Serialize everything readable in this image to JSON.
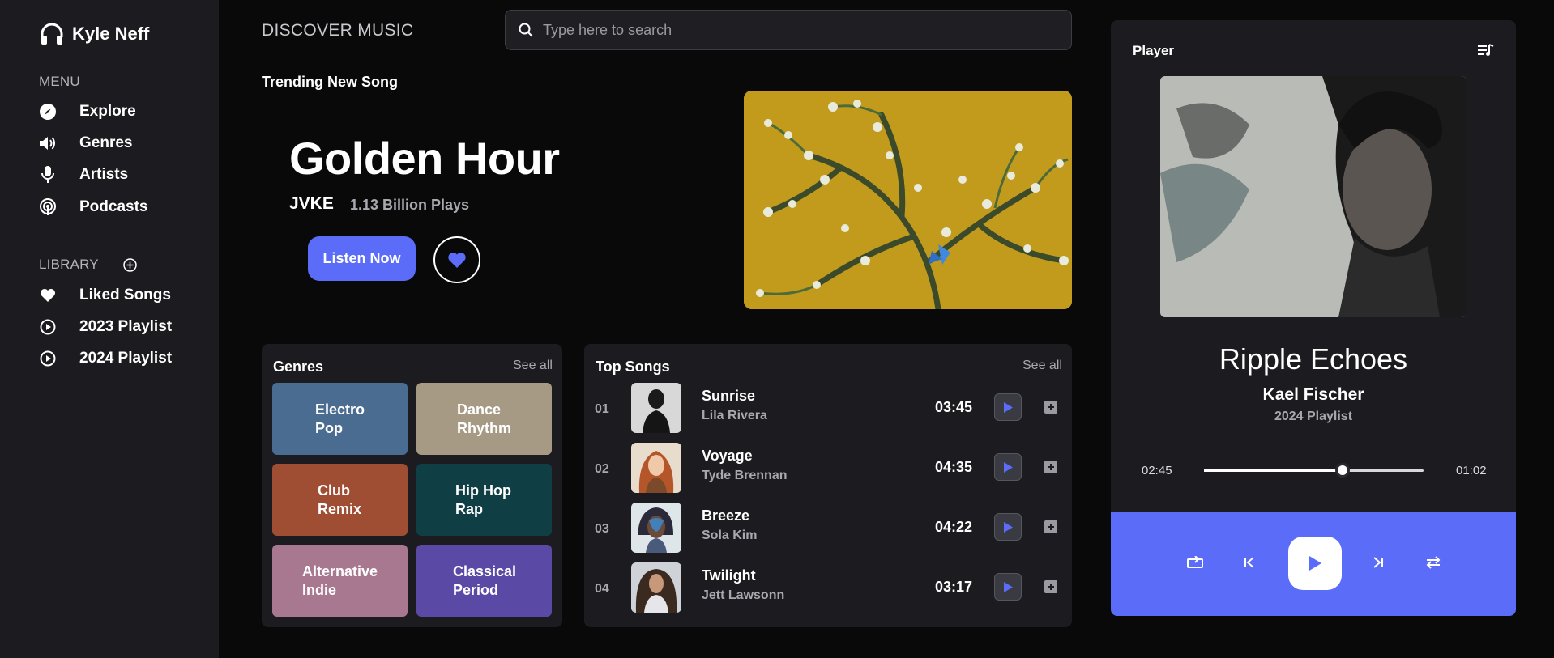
{
  "user": {
    "name": "Kyle Neff"
  },
  "sidebar": {
    "menu_label": "MENU",
    "menu_items": [
      {
        "label": "Explore",
        "icon": "compass-icon"
      },
      {
        "label": "Genres",
        "icon": "speaker-icon"
      },
      {
        "label": "Artists",
        "icon": "microphone-icon"
      },
      {
        "label": "Podcasts",
        "icon": "podcast-icon"
      }
    ],
    "library_label": "LIBRARY",
    "library_items": [
      {
        "label": "Liked Songs",
        "icon": "heart-icon"
      },
      {
        "label": "2023 Playlist",
        "icon": "play-circle-icon"
      },
      {
        "label": "2024 Playlist",
        "icon": "play-circle-icon"
      }
    ]
  },
  "header": {
    "title": "DISCOVER MUSIC",
    "search_placeholder": "Type here to search"
  },
  "hero": {
    "label": "Trending New Song",
    "title": "Golden Hour",
    "artist": "JVKE",
    "plays": "1.13 Billion Plays",
    "listen_label": "Listen Now"
  },
  "genres": {
    "title": "Genres",
    "see_all": "See all",
    "items": [
      {
        "line1": "Electro",
        "line2": "Pop",
        "color": "#4a6c90"
      },
      {
        "line1": "Dance",
        "line2": "Rhythm",
        "color": "#a69a84"
      },
      {
        "line1": "Club",
        "line2": "Remix",
        "color": "#a04e33"
      },
      {
        "line1": "Hip Hop",
        "line2": "Rap",
        "color": "#0f3f44"
      },
      {
        "line1": "Alternative",
        "line2": "Indie",
        "color": "#a87891"
      },
      {
        "line1": "Classical",
        "line2": "Period",
        "color": "#5a4aa5"
      }
    ]
  },
  "top_songs": {
    "title": "Top Songs",
    "see_all": "See all",
    "items": [
      {
        "num": "01",
        "title": "Sunrise",
        "artist": "Lila Rivera",
        "duration": "03:45"
      },
      {
        "num": "02",
        "title": "Voyage",
        "artist": "Tyde Brennan",
        "duration": "04:35"
      },
      {
        "num": "03",
        "title": "Breeze",
        "artist": "Sola Kim",
        "duration": "04:22"
      },
      {
        "num": "04",
        "title": "Twilight",
        "artist": "Jett Lawsonn",
        "duration": "03:17"
      }
    ]
  },
  "player": {
    "label": "Player",
    "title": "Ripple Echoes",
    "artist": "Kael Fischer",
    "playlist": "2024 Playlist",
    "elapsed": "02:45",
    "remaining": "01:02",
    "progress": 0.63
  },
  "colors": {
    "accent": "#5b6cf9",
    "background": "#09090a",
    "panel": "#1c1c20"
  }
}
